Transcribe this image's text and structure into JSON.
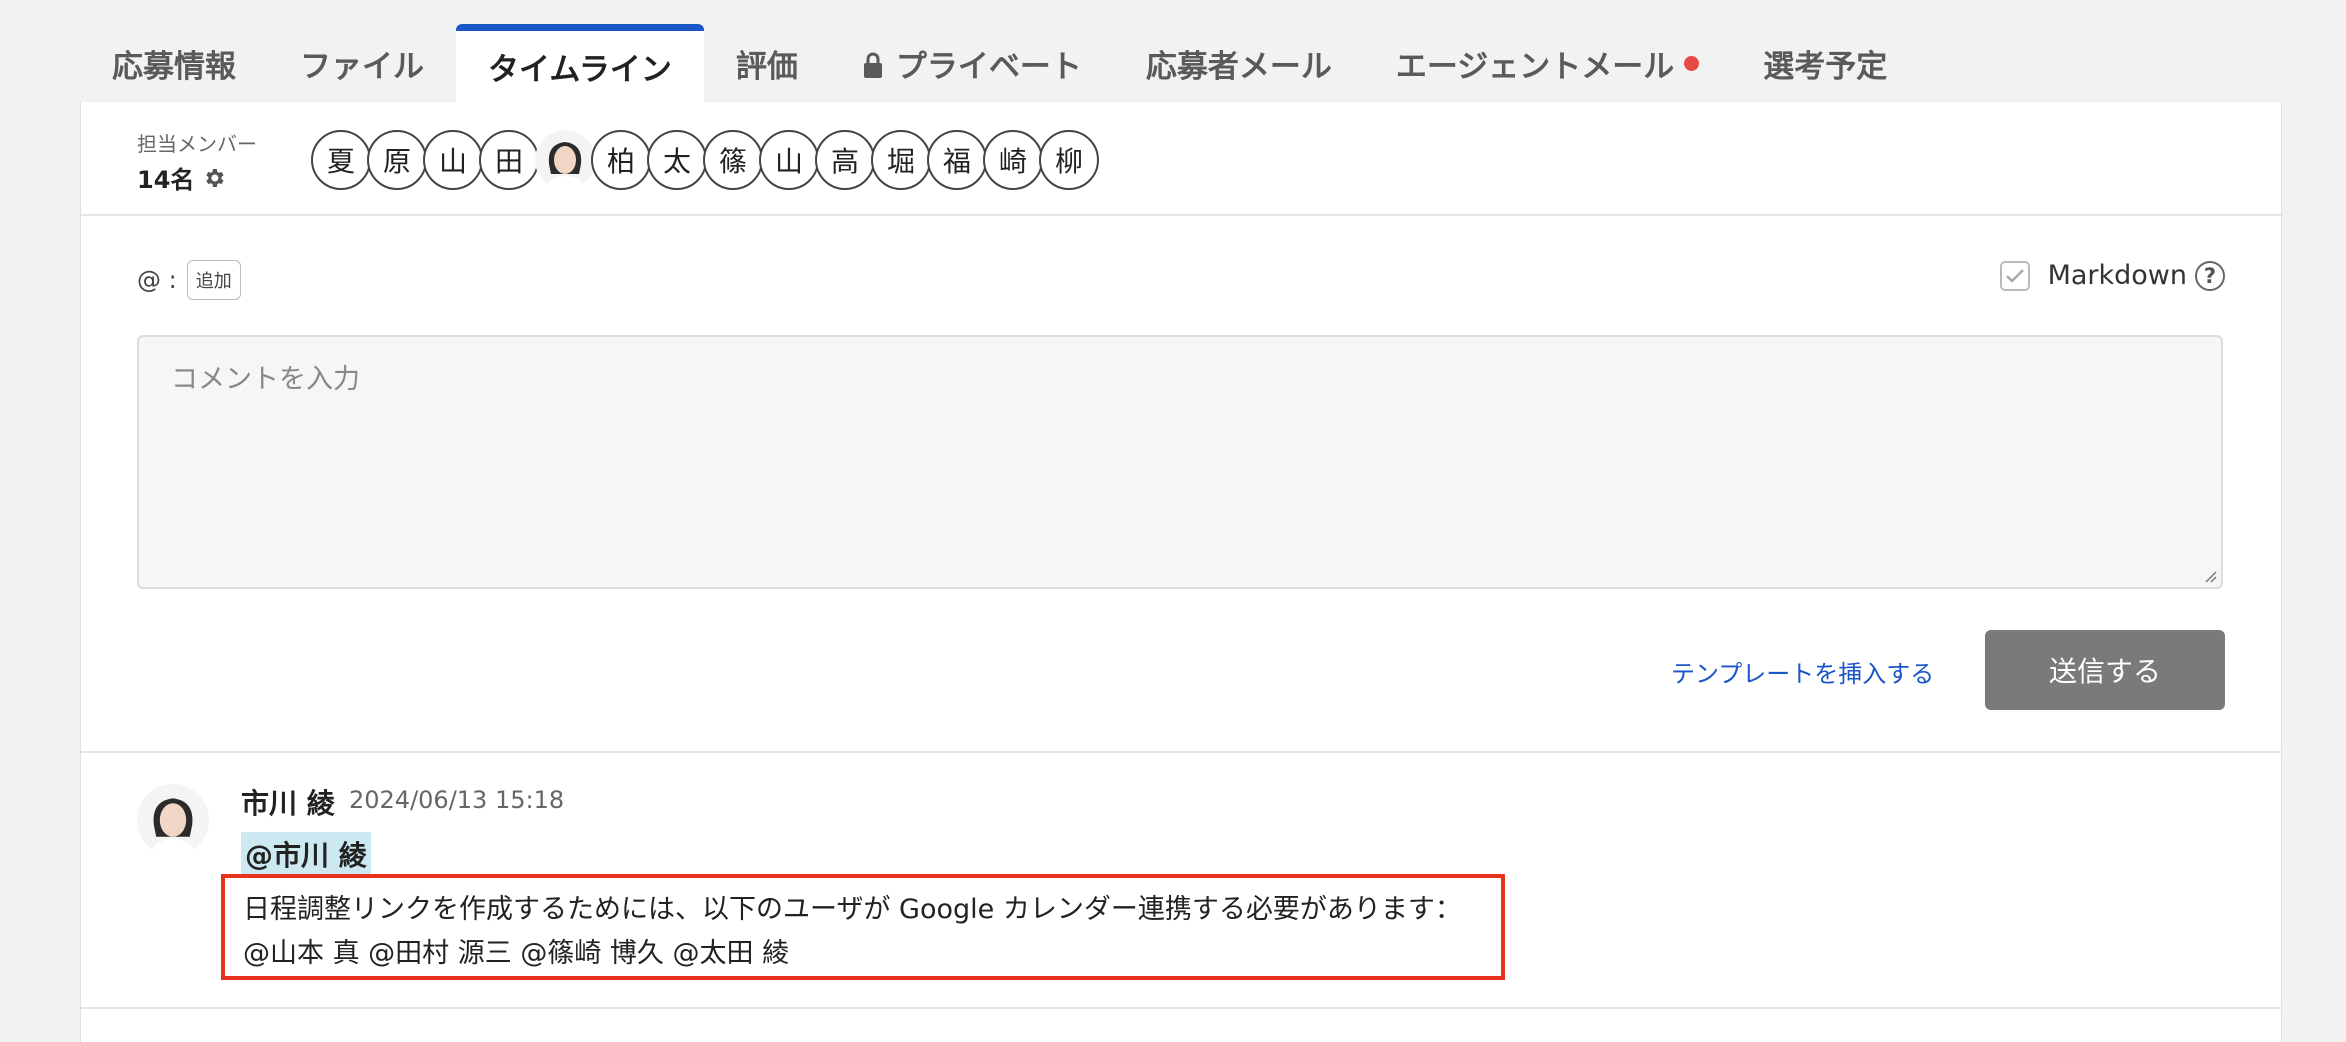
{
  "tabs": [
    {
      "label": "応募情報"
    },
    {
      "label": "ファイル"
    },
    {
      "label": "タイムライン",
      "active": true
    },
    {
      "label": "評価"
    },
    {
      "label": "プライベート",
      "icon": "lock-icon"
    },
    {
      "label": "応募者メール"
    },
    {
      "label": "エージェントメール",
      "badge": "notification-dot"
    },
    {
      "label": "選考予定"
    }
  ],
  "members": {
    "label": "担当メンバー",
    "count": "14名",
    "avatars": [
      "夏",
      "原",
      "山",
      "田",
      "photo",
      "柏",
      "太",
      "篠",
      "山",
      "高",
      "堀",
      "福",
      "崎",
      "柳"
    ]
  },
  "compose": {
    "mention_prefix": "@ :",
    "add_label": "追加",
    "markdown_label": "Markdown",
    "placeholder": "コメントを入力",
    "template_link": "テンプレートを挿入する",
    "send_label": "送信する"
  },
  "post": {
    "author": "市川 綾",
    "timestamp": "2024/06/13 15:18",
    "mention": "@市川 綾",
    "line1": "日程調整リンクを作成するためには、以下のユーザが Google カレンダー連携する必要があります：",
    "line2": "@山本 真 @田村 源三 @篠崎 博久 @太田 綾"
  },
  "colors": {
    "accent": "#1a56c7",
    "highlight_border": "#e8321e",
    "mention_bg": "#cce8f0",
    "send_button": "#7a7a7a"
  }
}
